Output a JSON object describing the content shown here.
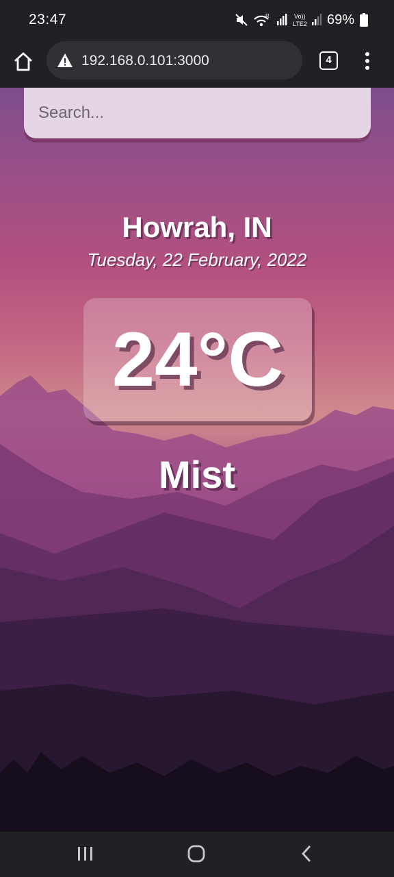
{
  "status_bar": {
    "time": "23:47",
    "battery": "69%",
    "icons": [
      "mute-icon",
      "wifi-icon",
      "signal-icon",
      "volte-icon",
      "battery-icon"
    ]
  },
  "browser": {
    "url": "192.168.0.101:3000",
    "tab_count": "4",
    "icons": [
      "home-icon",
      "warning-icon",
      "tabs-icon",
      "more-vert-icon"
    ]
  },
  "weather": {
    "search_placeholder": "Search...",
    "location": "Howrah, IN",
    "date": "Tuesday, 22 February, 2022",
    "temperature": "24°C",
    "condition": "Mist"
  },
  "nav_bar": {
    "icons": [
      "recents-icon",
      "home-nav-icon",
      "back-icon"
    ]
  },
  "colors": {
    "chrome_bg": "#202124",
    "url_pill": "#303134",
    "search_bg": "#e5d6e5",
    "text": "#ffffff"
  }
}
